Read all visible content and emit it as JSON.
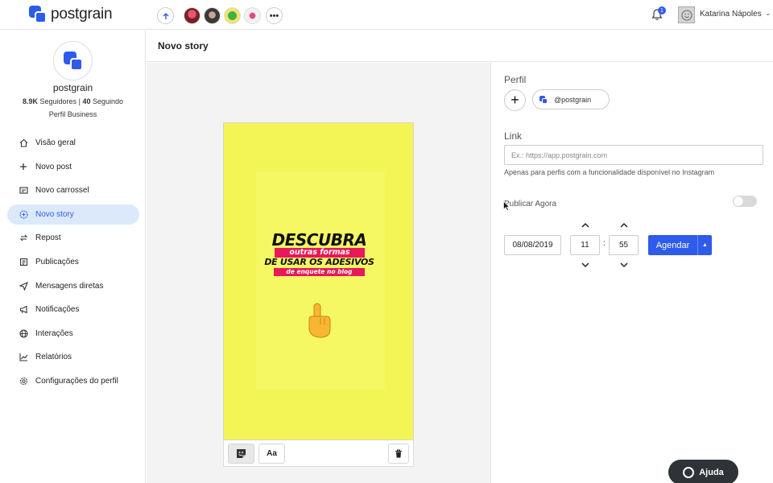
{
  "app": {
    "name": "postgrain",
    "brand_color": "#2e5bea"
  },
  "topbar": {
    "upload_icon": "arrow-up-icon",
    "more_icon": "ellipsis-icon",
    "more_label": "•••",
    "notifications_count": "1",
    "user_name": "Katarina Nápoles"
  },
  "sidebar": {
    "profile_name": "postgrain",
    "followers": "8.9K",
    "followers_label": "Seguidores",
    "separator": "|",
    "following": "40",
    "following_label": "Seguindo",
    "account_type": "Perfil Business",
    "items": [
      {
        "label": "Visão geral",
        "icon": "home-icon",
        "active": false
      },
      {
        "label": "Novo post",
        "icon": "plus-icon",
        "active": false
      },
      {
        "label": "Novo carrossel",
        "icon": "carousel-icon",
        "active": false
      },
      {
        "label": "Novo story",
        "icon": "story-icon",
        "active": true
      },
      {
        "label": "Repost",
        "icon": "repost-icon",
        "active": false
      },
      {
        "label": "Publicações",
        "icon": "publications-icon",
        "active": false
      },
      {
        "label": "Mensagens diretas",
        "icon": "send-icon",
        "active": false
      },
      {
        "label": "Notificações",
        "icon": "megaphone-icon",
        "active": false
      },
      {
        "label": "Interações",
        "icon": "globe-icon",
        "active": false
      },
      {
        "label": "Relatórios",
        "icon": "chart-icon",
        "active": false
      },
      {
        "label": "Configurações do perfil",
        "icon": "gear-icon",
        "active": false
      }
    ]
  },
  "page": {
    "title": "Novo story"
  },
  "story": {
    "background_color": "#f3f455",
    "headline": "DESCUBRA",
    "stripe1": "outras formas",
    "headline2": "DE USAR OS ADESIVOS",
    "stripe2": "de enquete no blog",
    "stripe_color": "#e8185a",
    "emoji_icon": "pointing-up-hand-icon"
  },
  "story_toolbar": {
    "sticker_icon": "sticker-icon",
    "text_label": "Aa",
    "trash_icon": "trash-icon"
  },
  "form": {
    "perfil_label": "Perfil",
    "add_label": "+",
    "profile_chip": "@postgrain",
    "link_label": "Link",
    "link_placeholder": "Ex.: https://app.postgrain.com",
    "link_value": "",
    "link_help": "Apenas para perfis com a funcionalidade disponível no Instagram",
    "publish_now_label": "Publicar Agora",
    "publish_now_on": false,
    "date": "08/08/2019",
    "hour": "11",
    "colon": ":",
    "minute": "55",
    "schedule_label": "Agendar"
  },
  "help": {
    "label": "Ajuda"
  }
}
